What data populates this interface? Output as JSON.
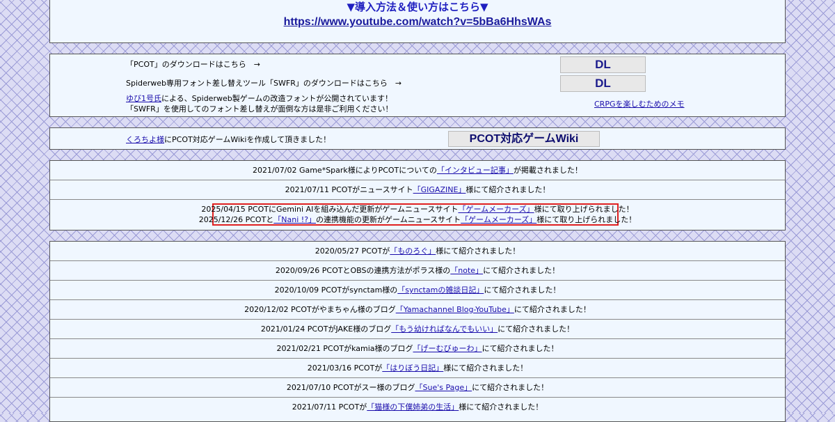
{
  "top": {
    "heading": "▼導入方法＆使い方はこちら▼",
    "url": "https://www.youtube.com/watch?v=5bBa6HhsWAs"
  },
  "download": {
    "pcot_text": "「PCOT」のダウンロードはこちら　→",
    "swfr_text": "Spiderweb専用フォント差し替えツール「SWFR」のダウンロードはこちら　→",
    "dl_label": "DL",
    "note_link": "ゆび1号氏",
    "note_text1": "による、Spiderweb製ゲームの改造フォントが公開されています！",
    "note_text2": "「SWFR」を使用してのフォント差し替えが面倒な方は是非ご利用ください！",
    "memo_link": "CRPGを楽しむためのメモ"
  },
  "wiki": {
    "link": "くろちよ様",
    "text": "にPCOT対応ゲームWikiを作成して頂きました！",
    "button": "PCOT対応ゲームWiki"
  },
  "news1": [
    {
      "pre": "2021/07/02 Game*Spark様によりPCOTについての",
      "link": "「インタビュー記事」",
      "post": "が掲載されました！"
    },
    {
      "pre": "2021/07/11 PCOTがニュースサイト",
      "link": "「GIGAZINE」",
      "post": "様にて紹介されました！"
    }
  ],
  "highlight": [
    {
      "pre": "2025/04/15 PCOTにGemini AIを組み込んだ更新がゲームニュースサイト",
      "link": "「ゲームメーカーズ」",
      "post": "様にて取り上げられました！"
    },
    {
      "pre": "2025/12/26 PCOTと",
      "link": "「Nani !?」",
      "mid": "の連携機能の更新がゲームニュースサイト",
      "link2": "「ゲームメーカーズ」",
      "post": "様にて取り上げられました！"
    }
  ],
  "news2": [
    {
      "pre": "2020/05/27 PCOTが",
      "link": "「ものろぐ」",
      "post": "様にて紹介されました！"
    },
    {
      "pre": "2020/09/26 PCOTとOBSの連携方法がポラス様の",
      "link": "「note」",
      "post": "にて紹介されました！"
    },
    {
      "pre": "2020/10/09 PCOTがsynctam様の",
      "link": "「synctamの雑談日記」",
      "post": "にて紹介されました！"
    },
    {
      "pre": "2020/12/02 PCOTがやまちゃん様のブログ",
      "link": "「Yamachannel Blog-YouTube」",
      "post": "にて紹介されました！"
    },
    {
      "pre": "2021/01/24 PCOTがJAKE様のブログ",
      "link": "「もう幼ければなんでもいい」",
      "post": "にて紹介されました！"
    },
    {
      "pre": "2021/02/21 PCOTがkamia様のブログ",
      "link": "「げーむびゅーわ」",
      "post": "にて紹介されました！"
    },
    {
      "pre": "2021/03/16 PCOTが",
      "link": "「はりぼう日記」",
      "post": "様にて紹介されました！"
    },
    {
      "pre": "2021/07/10 PCOTがスー様のブログ",
      "link": "「Sue's Page」",
      "post": "にて紹介されました！"
    },
    {
      "pre": "2021/07/11 PCOTが",
      "link": "「猫様の下僕姉弟の生活」",
      "post": "様にて紹介されました！"
    }
  ],
  "colors": {
    "highlight_border": "#e02020",
    "link": "#1a0dab",
    "box_bg": "#f0f7ff"
  }
}
